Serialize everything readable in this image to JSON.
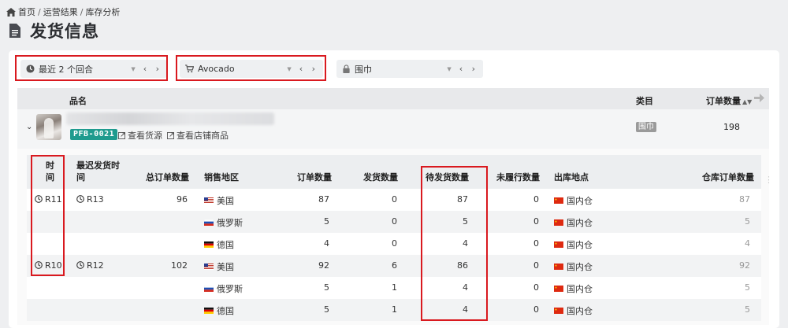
{
  "breadcrumb": {
    "home": "首页",
    "level2": "运营结果",
    "level3": "库存分析",
    "sep": "/"
  },
  "page": {
    "title": "发货信息"
  },
  "filters": {
    "time": {
      "label": "最近 2 个回合",
      "icon": "clock-icon"
    },
    "product": {
      "label": "Avocado",
      "icon": "cart-icon"
    },
    "category": {
      "label": "围巾",
      "icon": "lock-icon"
    },
    "caret": "▼",
    "nav": "‹ ›"
  },
  "product_table": {
    "headers": {
      "name": "品名",
      "category": "类目",
      "order_qty": "订单数量"
    },
    "row": {
      "sku": "PFB-0021",
      "link_source": "查看货源",
      "link_store": "查看店铺商品",
      "category": "围巾",
      "order_qty": "198"
    }
  },
  "detail_table": {
    "headers": {
      "time": "时间",
      "last_ship_time": "最迟发货时间",
      "total_orders": "总订单数量",
      "region": "销售地区",
      "orders": "订单数量",
      "shipped": "发货数量",
      "pending": "待发货数量",
      "unfulfilled": "未履行数量",
      "warehouse": "出库地点",
      "wh_orders": "仓库订单数量"
    },
    "rows": [
      {
        "time": "R11",
        "last": "R13",
        "total": "96",
        "region": "美国",
        "flag": "us",
        "orders": "87",
        "shipped": "0",
        "pending": "87",
        "unfulfilled": "0",
        "warehouse": "国内仓",
        "wh_orders": "87"
      },
      {
        "time": "",
        "last": "",
        "total": "",
        "region": "俄罗斯",
        "flag": "ru",
        "orders": "5",
        "shipped": "0",
        "pending": "5",
        "unfulfilled": "0",
        "warehouse": "国内仓",
        "wh_orders": "5"
      },
      {
        "time": "",
        "last": "",
        "total": "",
        "region": "德国",
        "flag": "de",
        "orders": "4",
        "shipped": "0",
        "pending": "4",
        "unfulfilled": "0",
        "warehouse": "国内仓",
        "wh_orders": "4"
      },
      {
        "time": "R10",
        "last": "R12",
        "total": "102",
        "region": "美国",
        "flag": "us",
        "orders": "92",
        "shipped": "6",
        "pending": "86",
        "unfulfilled": "0",
        "warehouse": "国内仓",
        "wh_orders": "92"
      },
      {
        "time": "",
        "last": "",
        "total": "",
        "region": "俄罗斯",
        "flag": "ru",
        "orders": "5",
        "shipped": "1",
        "pending": "4",
        "unfulfilled": "0",
        "warehouse": "国内仓",
        "wh_orders": "5"
      },
      {
        "time": "",
        "last": "",
        "total": "",
        "region": "德国",
        "flag": "de",
        "orders": "5",
        "shipped": "1",
        "pending": "4",
        "unfulfilled": "0",
        "warehouse": "国内仓",
        "wh_orders": "5"
      }
    ]
  },
  "colors": {
    "accent_badge": "#1f9b8e",
    "highlight": "#d9191f"
  }
}
